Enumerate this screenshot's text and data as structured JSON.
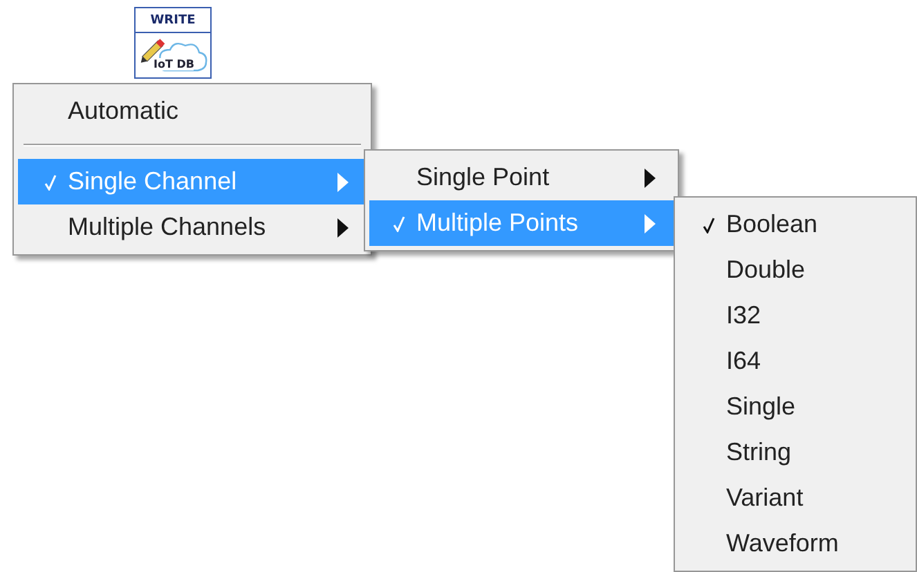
{
  "node": {
    "header": "WRITE",
    "caption": "IoT DB"
  },
  "menus": [
    {
      "items": [
        {
          "kind": "item",
          "label": "Automatic",
          "checked": false,
          "selected": false,
          "submenu": false
        },
        {
          "kind": "separator"
        },
        {
          "kind": "item",
          "label": "Single Channel",
          "checked": true,
          "selected": true,
          "submenu": true
        },
        {
          "kind": "item",
          "label": "Multiple Channels",
          "checked": false,
          "selected": false,
          "submenu": true
        }
      ]
    },
    {
      "items": [
        {
          "kind": "item",
          "label": "Single Point",
          "checked": false,
          "selected": false,
          "submenu": true
        },
        {
          "kind": "item",
          "label": "Multiple Points",
          "checked": true,
          "selected": true,
          "submenu": true
        }
      ]
    },
    {
      "items": [
        {
          "kind": "item",
          "label": "Boolean",
          "checked": true,
          "selected": false,
          "submenu": false
        },
        {
          "kind": "item",
          "label": "Double",
          "checked": false,
          "selected": false,
          "submenu": false
        },
        {
          "kind": "item",
          "label": "I32",
          "checked": false,
          "selected": false,
          "submenu": false
        },
        {
          "kind": "item",
          "label": "I64",
          "checked": false,
          "selected": false,
          "submenu": false
        },
        {
          "kind": "item",
          "label": "Single",
          "checked": false,
          "selected": false,
          "submenu": false
        },
        {
          "kind": "item",
          "label": "String",
          "checked": false,
          "selected": false,
          "submenu": false
        },
        {
          "kind": "item",
          "label": "Variant",
          "checked": false,
          "selected": false,
          "submenu": false
        },
        {
          "kind": "item",
          "label": "Waveform",
          "checked": false,
          "selected": false,
          "submenu": false
        }
      ]
    }
  ]
}
